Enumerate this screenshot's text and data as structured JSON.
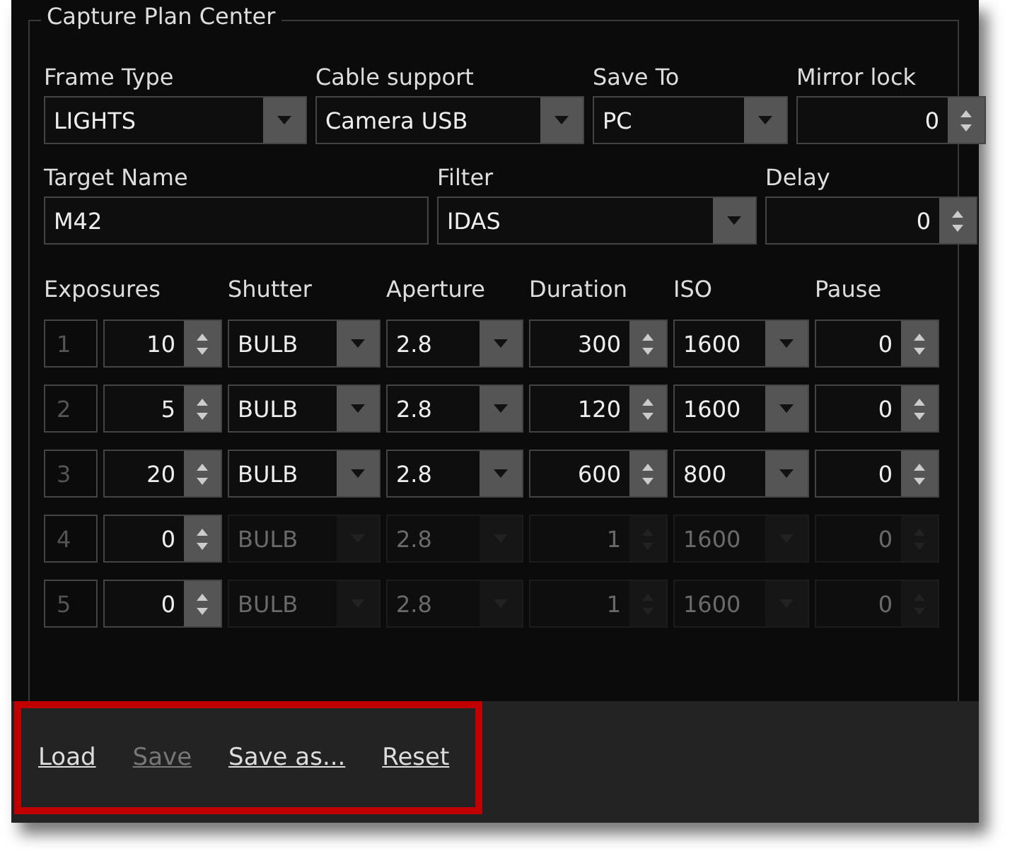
{
  "group_title": "Capture Plan Center",
  "top_fields": [
    {
      "label": "Frame Type",
      "kind": "dropdown",
      "value": "LIGHTS"
    },
    {
      "label": "Cable support",
      "kind": "dropdown",
      "value": "Camera USB"
    },
    {
      "label": "Save To",
      "kind": "dropdown",
      "value": "PC"
    },
    {
      "label": "Mirror lock",
      "kind": "spin",
      "value": "0"
    }
  ],
  "second_fields": [
    {
      "label": "Target Name",
      "kind": "text",
      "value": "M42"
    },
    {
      "label": "Filter",
      "kind": "dropdown",
      "value": "IDAS"
    },
    {
      "label": "Delay",
      "kind": "spin",
      "value": "0"
    }
  ],
  "columns": [
    "Exposures",
    "Shutter",
    "Aperture",
    "Duration",
    "ISO",
    "Pause"
  ],
  "rows": [
    {
      "index": "1",
      "exposures": "10",
      "shutter": "BULB",
      "aperture": "2.8",
      "duration": "300",
      "iso": "1600",
      "pause": "0",
      "disabled": false
    },
    {
      "index": "2",
      "exposures": "5",
      "shutter": "BULB",
      "aperture": "2.8",
      "duration": "120",
      "iso": "1600",
      "pause": "0",
      "disabled": false
    },
    {
      "index": "3",
      "exposures": "20",
      "shutter": "BULB",
      "aperture": "2.8",
      "duration": "600",
      "iso": "800",
      "pause": "0",
      "disabled": false
    },
    {
      "index": "4",
      "exposures": "0",
      "shutter": "BULB",
      "aperture": "2.8",
      "duration": "1",
      "iso": "1600",
      "pause": "0",
      "disabled": true
    },
    {
      "index": "5",
      "exposures": "0",
      "shutter": "BULB",
      "aperture": "2.8",
      "duration": "1",
      "iso": "1600",
      "pause": "0",
      "disabled": true
    }
  ],
  "links": [
    {
      "label": "Load",
      "disabled": false
    },
    {
      "label": "Save",
      "disabled": true
    },
    {
      "label": "Save as...",
      "disabled": false
    },
    {
      "label": "Reset",
      "disabled": false
    }
  ]
}
